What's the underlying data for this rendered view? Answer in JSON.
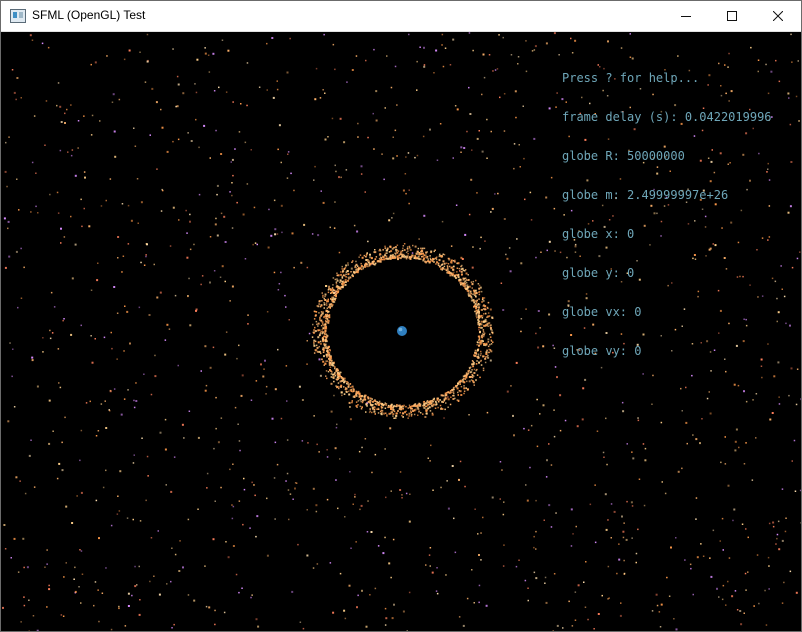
{
  "window": {
    "title": "SFML (OpenGL) Test",
    "controls": {
      "minimize": "minimize",
      "maximize": "maximize",
      "close": "close"
    }
  },
  "hud": {
    "help": "Press ? for help...",
    "frame_delay": "frame delay (s): 0.0422019996",
    "globe_r": "globe R: 50000000",
    "globe_m": "globe m: 2.49999997e+26",
    "globe_x": "globe x: 0",
    "globe_y": "globe y: 0",
    "globe_vx": "globe vx: 0",
    "globe_vy": "globe vy: 0"
  },
  "scene": {
    "background": "#000000",
    "hud_color": "#6ea6b8",
    "globe_color": "#2f7fc0",
    "particle_colors": [
      "#ffb36b",
      "#ff9a4a",
      "#ffd08a",
      "#ff7f5c",
      "#ffe0b0",
      "#d98cff"
    ]
  }
}
